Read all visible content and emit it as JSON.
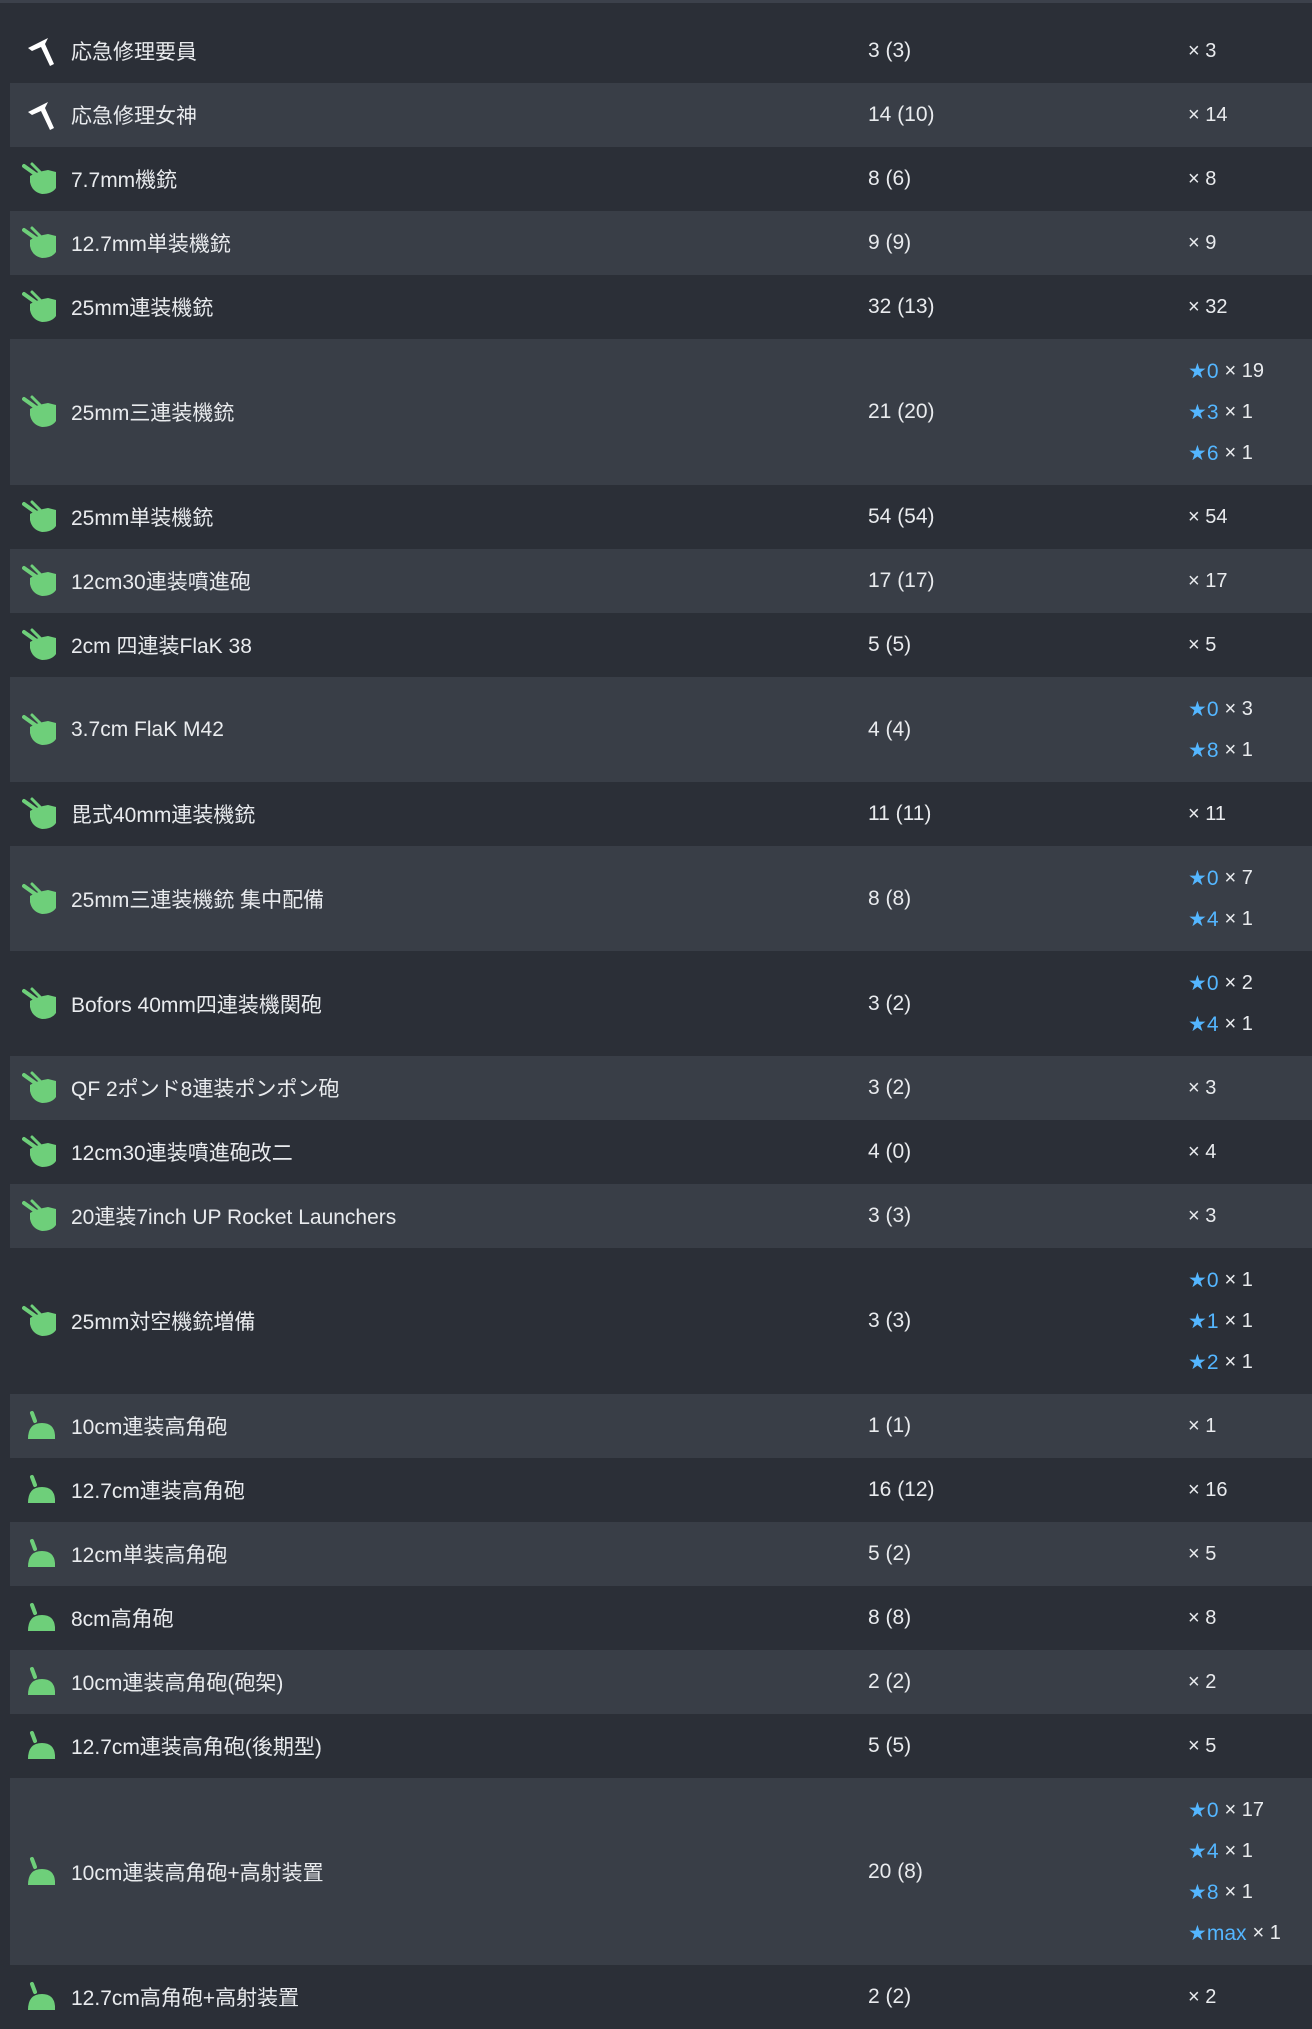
{
  "colors": {
    "background": "#2b2f37",
    "row_alt": "#393e47",
    "star": "#54b6ff",
    "aa_icon": "#6ecf7a",
    "text": "#e9ebee"
  },
  "items": [
    {
      "name": "応急修理要員",
      "count": "3 (3)",
      "icon": "repair-icon",
      "stars": [
        {
          "star": "",
          "mult": "× 3"
        }
      ]
    },
    {
      "name": "応急修理女神",
      "count": "14 (10)",
      "icon": "repair-icon",
      "stars": [
        {
          "star": "",
          "mult": "× 14"
        }
      ]
    },
    {
      "name": "7.7mm機銃",
      "count": "8 (6)",
      "icon": "aa-gun-icon",
      "stars": [
        {
          "star": "",
          "mult": "× 8"
        }
      ]
    },
    {
      "name": "12.7mm単装機銃",
      "count": "9 (9)",
      "icon": "aa-gun-icon",
      "stars": [
        {
          "star": "",
          "mult": "× 9"
        }
      ]
    },
    {
      "name": "25mm連装機銃",
      "count": "32 (13)",
      "icon": "aa-gun-icon",
      "stars": [
        {
          "star": "",
          "mult": "× 32"
        }
      ]
    },
    {
      "name": "25mm三連装機銃",
      "count": "21 (20)",
      "icon": "aa-gun-icon",
      "stars": [
        {
          "star": "★0",
          "mult": "× 19"
        },
        {
          "star": "★3",
          "mult": "× 1"
        },
        {
          "star": "★6",
          "mult": "× 1"
        }
      ]
    },
    {
      "name": "25mm単装機銃",
      "count": "54 (54)",
      "icon": "aa-gun-icon",
      "stars": [
        {
          "star": "",
          "mult": "× 54"
        }
      ]
    },
    {
      "name": "12cm30連装噴進砲",
      "count": "17 (17)",
      "icon": "aa-gun-icon",
      "stars": [
        {
          "star": "",
          "mult": "× 17"
        }
      ]
    },
    {
      "name": "2cm 四連装FlaK 38",
      "count": "5 (5)",
      "icon": "aa-gun-icon",
      "stars": [
        {
          "star": "",
          "mult": "× 5"
        }
      ]
    },
    {
      "name": "3.7cm FlaK M42",
      "count": "4 (4)",
      "icon": "aa-gun-icon",
      "stars": [
        {
          "star": "★0",
          "mult": "× 3"
        },
        {
          "star": "★8",
          "mult": "× 1"
        }
      ]
    },
    {
      "name": "毘式40mm連装機銃",
      "count": "11 (11)",
      "icon": "aa-gun-icon",
      "stars": [
        {
          "star": "",
          "mult": "× 11"
        }
      ]
    },
    {
      "name": "25mm三連装機銃 集中配備",
      "count": "8 (8)",
      "icon": "aa-gun-icon",
      "stars": [
        {
          "star": "★0",
          "mult": "× 7"
        },
        {
          "star": "★4",
          "mult": "× 1"
        }
      ]
    },
    {
      "name": "Bofors 40mm四連装機関砲",
      "count": "3 (2)",
      "icon": "aa-gun-icon",
      "stars": [
        {
          "star": "★0",
          "mult": "× 2"
        },
        {
          "star": "★4",
          "mult": "× 1"
        }
      ]
    },
    {
      "name": "QF 2ポンド8連装ポンポン砲",
      "count": "3 (2)",
      "icon": "aa-gun-icon",
      "stars": [
        {
          "star": "",
          "mult": "× 3"
        }
      ]
    },
    {
      "name": "12cm30連装噴進砲改二",
      "count": "4 (0)",
      "icon": "aa-gun-icon",
      "stars": [
        {
          "star": "",
          "mult": "× 4"
        }
      ]
    },
    {
      "name": "20連装7inch UP Rocket Launchers",
      "count": "3 (3)",
      "icon": "aa-gun-icon",
      "stars": [
        {
          "star": "",
          "mult": "× 3"
        }
      ]
    },
    {
      "name": "25mm対空機銃増備",
      "count": "3 (3)",
      "icon": "aa-gun-icon",
      "stars": [
        {
          "star": "★0",
          "mult": "× 1"
        },
        {
          "star": "★1",
          "mult": "× 1"
        },
        {
          "star": "★2",
          "mult": "× 1"
        }
      ]
    },
    {
      "name": "10cm連装高角砲",
      "count": "1 (1)",
      "icon": "high-angle-gun-icon",
      "stars": [
        {
          "star": "",
          "mult": "× 1"
        }
      ]
    },
    {
      "name": "12.7cm連装高角砲",
      "count": "16 (12)",
      "icon": "high-angle-gun-icon",
      "stars": [
        {
          "star": "",
          "mult": "× 16"
        }
      ]
    },
    {
      "name": "12cm単装高角砲",
      "count": "5 (2)",
      "icon": "high-angle-gun-icon",
      "stars": [
        {
          "star": "",
          "mult": "× 5"
        }
      ]
    },
    {
      "name": "8cm高角砲",
      "count": "8 (8)",
      "icon": "high-angle-gun-icon",
      "stars": [
        {
          "star": "",
          "mult": "× 8"
        }
      ]
    },
    {
      "name": "10cm連装高角砲(砲架)",
      "count": "2 (2)",
      "icon": "high-angle-gun-icon",
      "stars": [
        {
          "star": "",
          "mult": "× 2"
        }
      ]
    },
    {
      "name": "12.7cm連装高角砲(後期型)",
      "count": "5 (5)",
      "icon": "high-angle-gun-icon",
      "stars": [
        {
          "star": "",
          "mult": "× 5"
        }
      ]
    },
    {
      "name": "10cm連装高角砲+高射装置",
      "count": "20 (8)",
      "icon": "high-angle-gun-icon",
      "stars": [
        {
          "star": "★0",
          "mult": "× 17"
        },
        {
          "star": "★4",
          "mult": "× 1"
        },
        {
          "star": "★8",
          "mult": "× 1"
        },
        {
          "star": "★max",
          "mult": "× 1"
        }
      ]
    },
    {
      "name": "12.7cm高角砲+高射装置",
      "count": "2 (2)",
      "icon": "high-angle-gun-icon",
      "stars": [
        {
          "star": "",
          "mult": "× 2"
        }
      ]
    }
  ]
}
